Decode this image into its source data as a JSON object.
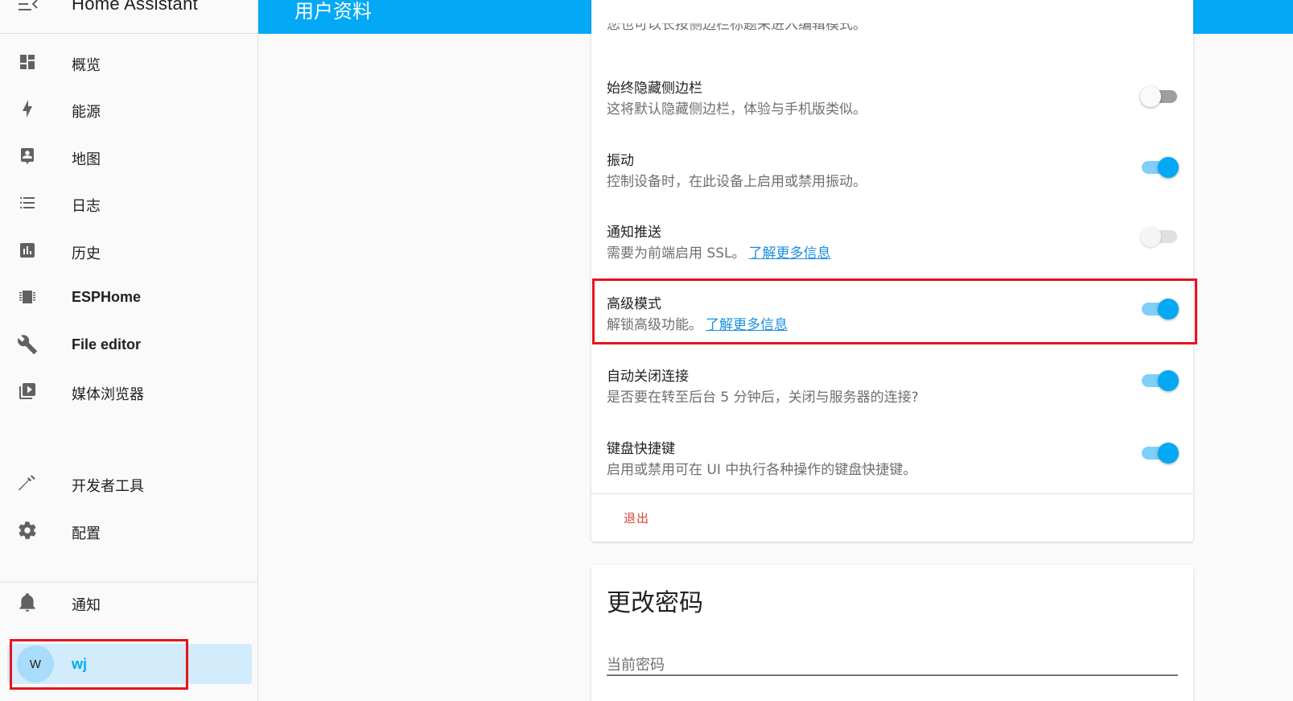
{
  "app": {
    "title": "Home Assistant"
  },
  "topbar": {
    "title": "用户资料"
  },
  "sidebar": {
    "items": [
      {
        "label": "概览",
        "icon": "dashboard-icon"
      },
      {
        "label": "能源",
        "icon": "lightning-bolt-icon"
      },
      {
        "label": "地图",
        "icon": "map-account-icon"
      },
      {
        "label": "日志",
        "icon": "list-icon"
      },
      {
        "label": "历史",
        "icon": "chart-box-icon"
      },
      {
        "label": "ESPHome",
        "icon": "chip-icon"
      },
      {
        "label": "File editor",
        "icon": "wrench-icon"
      },
      {
        "label": "媒体浏览器",
        "icon": "play-box-icon"
      }
    ],
    "bottom_items": [
      {
        "label": "开发者工具",
        "icon": "hammer-icon"
      },
      {
        "label": "配置",
        "icon": "gear-icon"
      }
    ],
    "notifications": {
      "label": "通知",
      "icon": "bell-icon"
    },
    "user": {
      "initial": "W",
      "name": "wj"
    }
  },
  "profile": {
    "top_cut_text": "您也可以长按侧边栏标题来进入编辑模式。",
    "settings": [
      {
        "title": "始终隐藏侧边栏",
        "description": "这将默认隐藏侧边栏，体验与手机版类似。",
        "link": "",
        "state": "off"
      },
      {
        "title": "振动",
        "description": "控制设备时，在此设备上启用或禁用振动。",
        "link": "",
        "state": "on"
      },
      {
        "title": "通知推送",
        "description": "需要为前端启用 SSL。",
        "link": "了解更多信息",
        "state": "disabled"
      },
      {
        "title": "高级模式",
        "description": "解锁高级功能。",
        "link": "了解更多信息",
        "state": "on"
      },
      {
        "title": "自动关闭连接",
        "description": "是否要在转至后台 5 分钟后，关闭与服务器的连接?",
        "link": "",
        "state": "on"
      },
      {
        "title": "键盘快捷键",
        "description": "启用或禁用可在 UI 中执行各种操作的键盘快捷键。",
        "link": "",
        "state": "on"
      }
    ],
    "logout_label": "退出"
  },
  "change_password": {
    "title": "更改密码",
    "current_password_label": "当前密码"
  },
  "colors": {
    "primary": "#03a9f4",
    "highlight": "#e8141c",
    "logout": "#db4437",
    "user_bg": "#d2ecfb"
  }
}
